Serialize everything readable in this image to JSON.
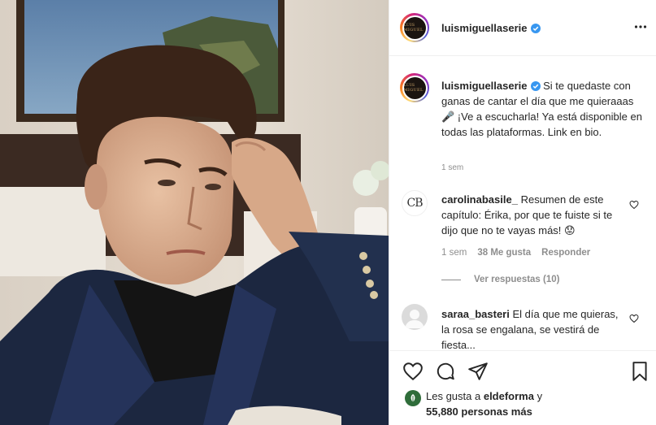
{
  "post": {
    "username": "luismiguellaserie",
    "avatar_text": "LUIS MIGUEL",
    "caption": "Si te quedaste con ganas de cantar el día que me quieraaas 🎤 ¡Ve a escucharla! Ya está disponible en todas las plataformas. Link en bio.",
    "caption_time": "1 sem"
  },
  "comments": [
    {
      "username": "carolinabasile_",
      "avatar_text": "CB",
      "text": "Resumen de este capítulo: Érika, por que te fuiste si te dijo que no te vayas más! 😟",
      "time": "1 sem",
      "likes": "38 Me gusta",
      "reply": "Responder",
      "view_replies": "Ver respuestas (10)"
    },
    {
      "username": "saraa_basteri",
      "text": "El día que me quieras, la rosa se engalana, se vestirá de fiesta..."
    }
  ],
  "likes": {
    "prefix": "Les gusta a",
    "user": "eldeforma",
    "connector": "y",
    "others": "55,880 personas más"
  },
  "icons": [
    "more-icon",
    "verified-icon",
    "heart-icon",
    "comment-icon",
    "share-icon",
    "bookmark-icon"
  ],
  "colors": {
    "verified": "#3897f0",
    "muted": "#8e8e8e",
    "text": "#262626"
  }
}
